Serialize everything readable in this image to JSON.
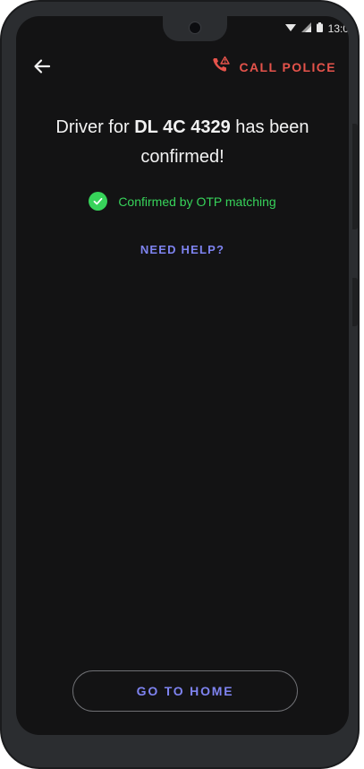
{
  "status_bar": {
    "time": "13:0",
    "icons": [
      "wifi-icon",
      "signal-icon",
      "battery-icon"
    ]
  },
  "header": {
    "back_icon": "back-arrow-icon",
    "call_police_icon": "phone-alert-icon",
    "call_police_label": "CALL POLICE"
  },
  "confirmation": {
    "prefix": "Driver for ",
    "plate": "DL 4C 4329",
    "suffix": " has been confirmed!",
    "method_icon": "check-circle-icon",
    "method_text": "Confirmed by OTP matching"
  },
  "help": {
    "label": "NEED HELP?"
  },
  "footer": {
    "home_label": "GO TO HOME"
  },
  "colors": {
    "background": "#131314",
    "accent": "#7e83f0",
    "success": "#37d35a",
    "danger": "#e5534b",
    "frame": "#2b2d30"
  }
}
